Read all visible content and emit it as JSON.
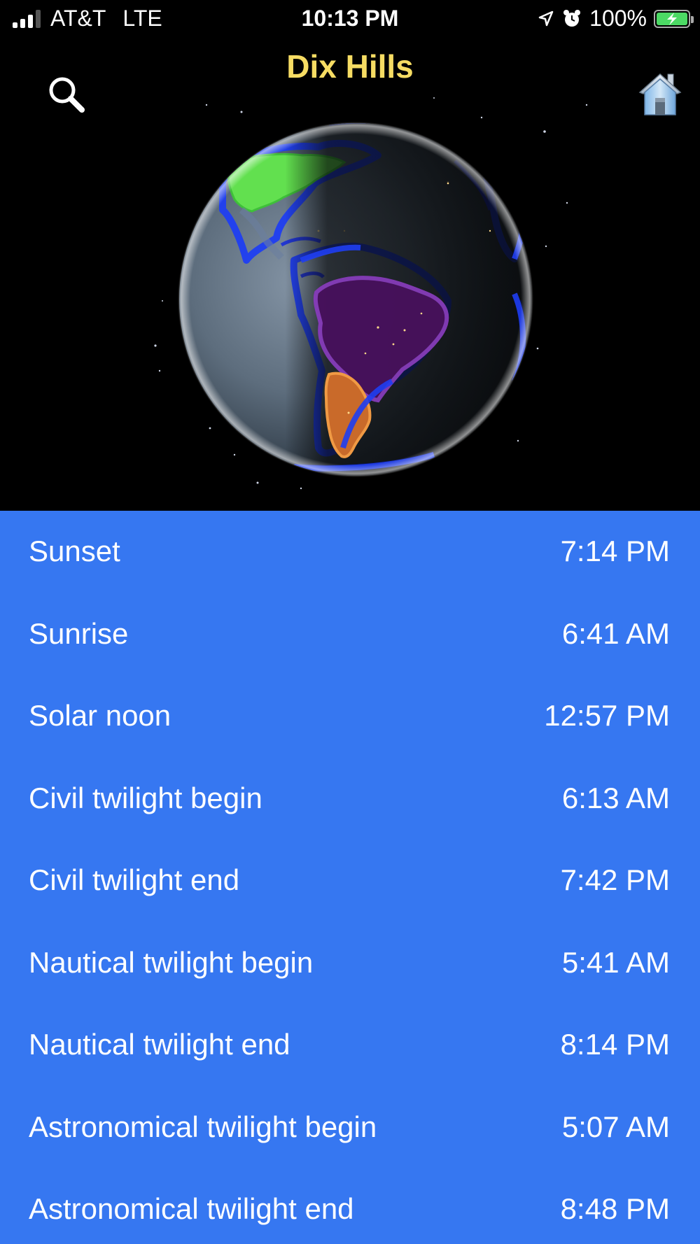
{
  "status_bar": {
    "carrier": "AT&T",
    "network": "LTE",
    "time": "10:13 PM",
    "battery": "100%",
    "battery_color": "#4cd964",
    "icons": [
      "signal-icon",
      "location-arrow-icon",
      "alarm-icon",
      "battery-icon"
    ]
  },
  "header": {
    "title": "Dix Hills",
    "title_color": "#f6dc63",
    "search_icon": "search-icon",
    "home_icon": "home-icon"
  },
  "globe": {
    "icon": "earth-globe",
    "highlighted_regions": [
      "north-america",
      "brazil",
      "argentina"
    ]
  },
  "list_background": "#3677f1",
  "times": [
    {
      "label": "Sunset",
      "value": "7:14 PM"
    },
    {
      "label": "Sunrise",
      "value": "6:41 AM"
    },
    {
      "label": "Solar noon",
      "value": "12:57 PM"
    },
    {
      "label": "Civil twilight begin",
      "value": "6:13 AM"
    },
    {
      "label": "Civil twilight end",
      "value": "7:42 PM"
    },
    {
      "label": "Nautical twilight begin",
      "value": "5:41 AM"
    },
    {
      "label": "Nautical twilight end",
      "value": "8:14 PM"
    },
    {
      "label": "Astronomical twilight begin",
      "value": "5:07 AM"
    },
    {
      "label": "Astronomical twilight end",
      "value": "8:48 PM"
    }
  ]
}
